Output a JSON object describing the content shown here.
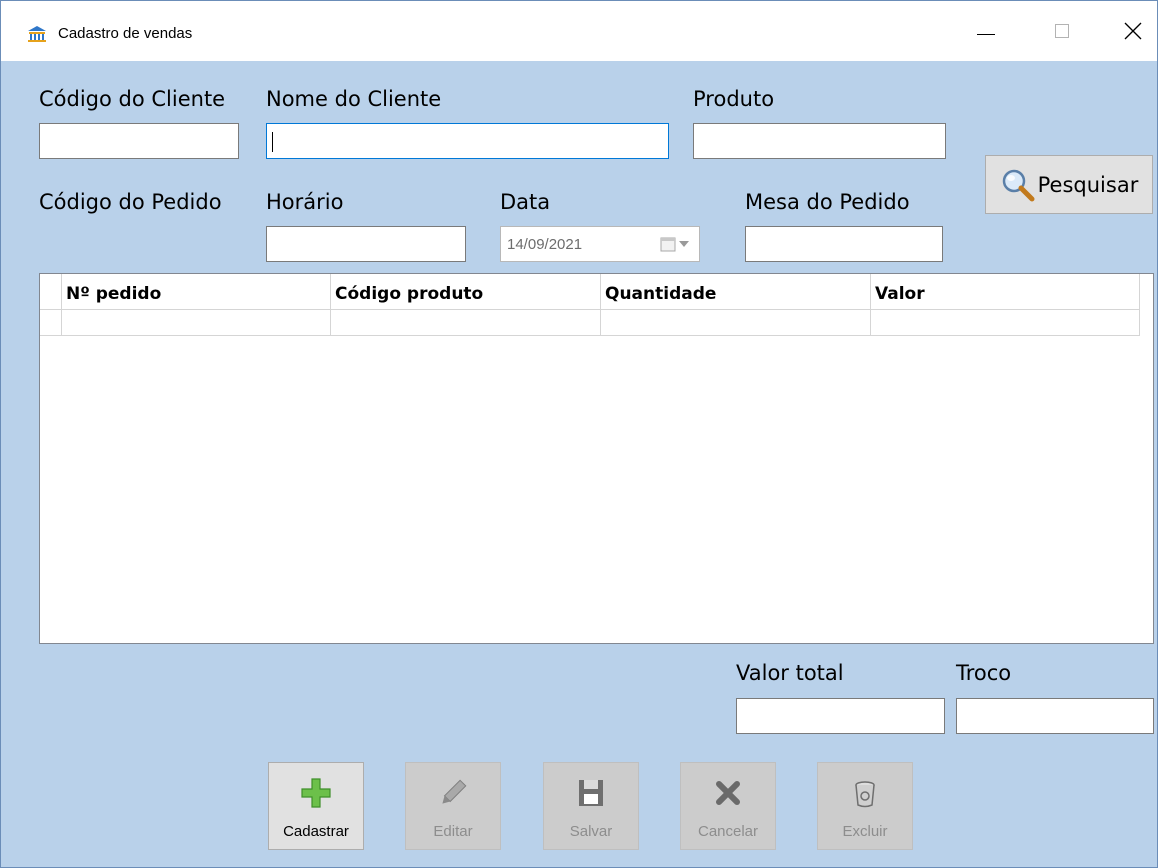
{
  "window": {
    "title": "Cadastro de vendas"
  },
  "form": {
    "codigo_cliente": {
      "label": "Código do Cliente",
      "value": ""
    },
    "nome_cliente": {
      "label": "Nome do Cliente",
      "value": ""
    },
    "produto": {
      "label": "Produto",
      "value": ""
    },
    "codigo_pedido": {
      "label": "Código do Pedido"
    },
    "horario": {
      "label": "Horário",
      "value": ""
    },
    "data": {
      "label": "Data",
      "value": "14/09/2021"
    },
    "mesa_pedido": {
      "label": "Mesa do Pedido",
      "value": ""
    },
    "search_button": "Pesquisar"
  },
  "grid": {
    "columns": [
      "Nº pedido",
      "Código produto",
      "Quantidade",
      "Valor"
    ]
  },
  "totals": {
    "valor_total": {
      "label": "Valor total",
      "value": ""
    },
    "troco": {
      "label": "Troco",
      "value": ""
    }
  },
  "actions": {
    "cadastrar": "Cadastrar",
    "editar": "Editar",
    "salvar": "Salvar",
    "cancelar": "Cancelar",
    "excluir": "Excluir"
  },
  "icons": {
    "app": "bank-icon",
    "search": "magnifier-icon",
    "cadastrar": "plus-icon",
    "editar": "pencil-icon",
    "salvar": "floppy-disk-icon",
    "cancelar": "x-icon",
    "excluir": "trash-icon"
  },
  "colors": {
    "form_background": "#b9d1ea",
    "focus_border": "#0078d7",
    "add_green": "#6cc04a"
  }
}
